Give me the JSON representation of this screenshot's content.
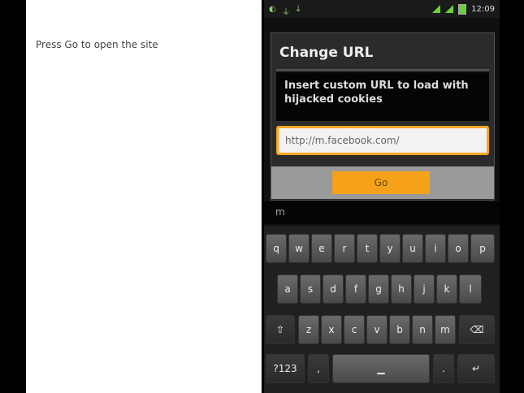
{
  "left": {
    "instruction": "Press Go to open the site"
  },
  "status_bar": {
    "time": "12:09"
  },
  "dialog": {
    "title": "Change URL",
    "message": "Insert custom URL to load with hijacked cookies",
    "url_value": "http://m.facebook.com/",
    "go_label": "Go"
  },
  "suggestion": "m",
  "keyboard": {
    "row1": [
      "q",
      "w",
      "e",
      "r",
      "t",
      "y",
      "u",
      "i",
      "o",
      "p"
    ],
    "row2": [
      "a",
      "s",
      "d",
      "f",
      "g",
      "h",
      "j",
      "k",
      "l"
    ],
    "row3": [
      "z",
      "x",
      "c",
      "v",
      "b",
      "n",
      "m"
    ],
    "sym_label": "?123",
    "comma": ",",
    "period": "."
  }
}
